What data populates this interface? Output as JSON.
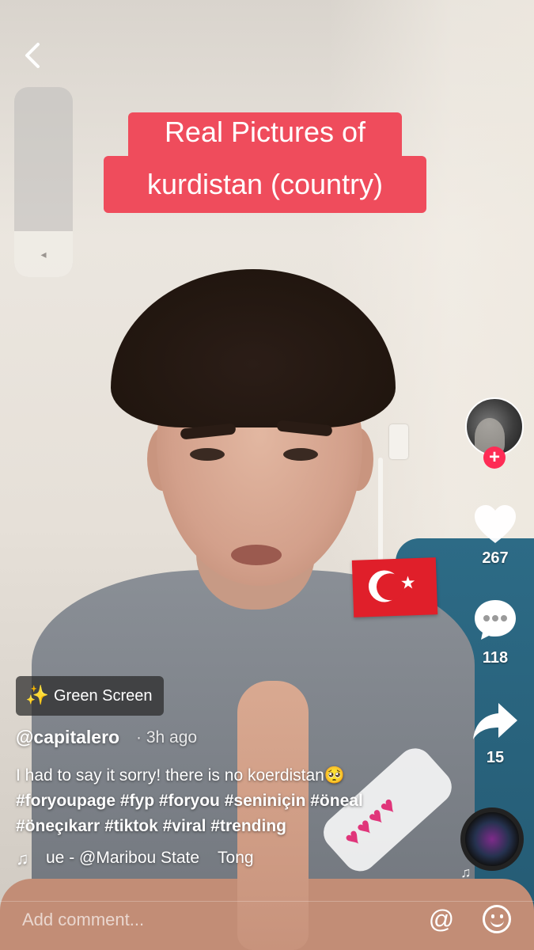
{
  "video": {
    "caption_line1": "Real Pictures of",
    "caption_line2": "kurdistan (country)",
    "flag_sticker": "🇹🇷"
  },
  "sidebar": {
    "like_count": "267",
    "comment_count": "118",
    "share_count": "15"
  },
  "post": {
    "effect_label": "Green Screen",
    "username": "@capitalero",
    "time_ago": "· 3h ago",
    "description_text": "I had to say it sorry! there is no koerdistan🥺",
    "hashtags_line1": "#foryoupage #fyp #foryou #seniniçin #öneal",
    "hashtags_line2": "#öneçıkarr #tiktok #viral #trending",
    "song": "ue - @Maribou State    Tong"
  },
  "volume": {
    "level": 0.24
  },
  "comment_bar": {
    "placeholder": "Add comment..."
  },
  "colors": {
    "caption_bg": "#ef4c5c",
    "follow_button": "#fe2c55"
  },
  "icons": [
    "back-icon",
    "volume-icon",
    "heart-icon",
    "comment-icon",
    "share-icon",
    "music-disc-icon",
    "music-note-icon",
    "at-icon",
    "emoji-icon",
    "green-screen-icon"
  ]
}
